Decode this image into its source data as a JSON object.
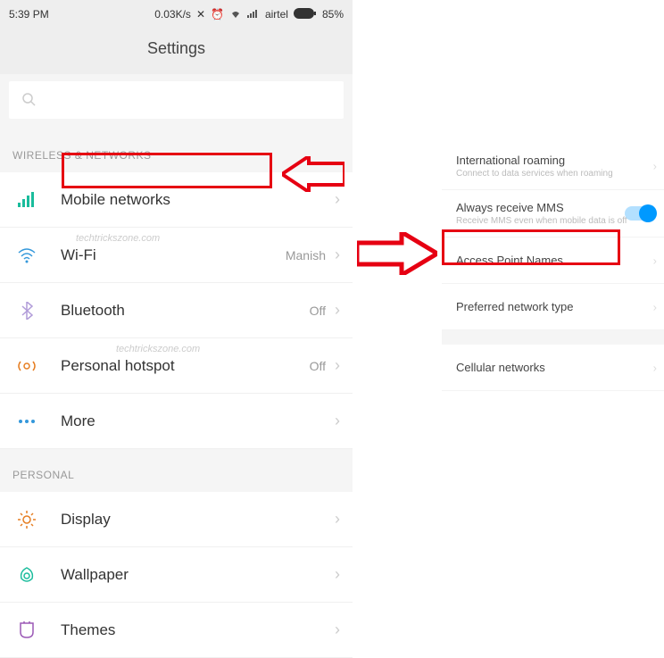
{
  "statusbar": {
    "time": "5:39 PM",
    "speed": "0.03K/s",
    "carrier": "airtel",
    "battery": "85%"
  },
  "header": {
    "title": "Settings"
  },
  "search": {
    "placeholder": ""
  },
  "sections": {
    "wireless": {
      "title": "WIRELESS & NETWORKS",
      "items": [
        {
          "label": "Mobile networks",
          "value": ""
        },
        {
          "label": "Wi-Fi",
          "value": "Manish"
        },
        {
          "label": "Bluetooth",
          "value": "Off"
        },
        {
          "label": "Personal hotspot",
          "value": "Off"
        },
        {
          "label": "More",
          "value": ""
        }
      ]
    },
    "personal": {
      "title": "PERSONAL",
      "items": [
        {
          "label": "Display",
          "value": ""
        },
        {
          "label": "Wallpaper",
          "value": ""
        },
        {
          "label": "Themes",
          "value": ""
        }
      ]
    }
  },
  "right": {
    "items": [
      {
        "title": "International roaming",
        "sub": "Connect to data services when roaming",
        "chevron": true
      },
      {
        "title": "Always receive MMS",
        "sub": "Receive MMS even when mobile data is off",
        "toggle": true
      },
      {
        "title": "Access Point Names",
        "sub": "",
        "chevron": true
      },
      {
        "title": "Preferred network type",
        "sub": "",
        "chevron": true
      },
      {
        "title": "Cellular networks",
        "sub": "",
        "chevron": true
      }
    ]
  },
  "watermark": "techtrickszone.com",
  "colors": {
    "highlight": "#e60012",
    "accent": "#0099ff"
  }
}
